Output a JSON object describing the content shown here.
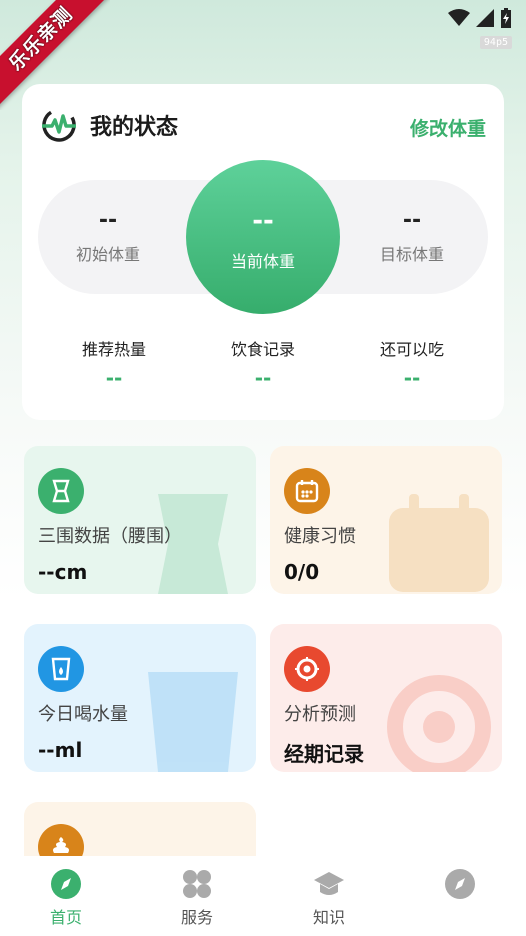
{
  "statusbar": {
    "fps": "94p5"
  },
  "ribbon": {
    "text": "乐乐亲测"
  },
  "status_card": {
    "title": "我的状态",
    "edit_label": "修改体重",
    "initial": {
      "value": "--",
      "label": "初始体重"
    },
    "current": {
      "value": "--",
      "label": "当前体重"
    },
    "target": {
      "value": "--",
      "label": "目标体重"
    },
    "stats": [
      {
        "label": "推荐热量",
        "value": "--"
      },
      {
        "label": "饮食记录",
        "value": "--"
      },
      {
        "label": "还可以吃",
        "value": "--"
      }
    ]
  },
  "tiles": [
    {
      "title": "三围数据（腰围）",
      "value": "--cm",
      "icon": "waist-icon",
      "color": "#3bb06e"
    },
    {
      "title": "健康习惯",
      "value": "0/0",
      "icon": "calendar-icon",
      "color": "#d8841a"
    },
    {
      "title": "今日喝水量",
      "value": "--ml",
      "icon": "water-cup-icon",
      "color": "#2196e3"
    },
    {
      "title": "分析预测",
      "value": "经期记录",
      "icon": "flower-icon",
      "color": "#e8492f"
    },
    {
      "title": "",
      "value": "",
      "icon": "poop-icon",
      "color": "#d8841a"
    }
  ],
  "tabs": [
    {
      "label": "首页",
      "icon": "compass-icon",
      "active": true
    },
    {
      "label": "服务",
      "icon": "grid-icon",
      "active": false
    },
    {
      "label": "知识",
      "icon": "graduation-cap-icon",
      "active": false
    },
    {
      "label": "",
      "icon": "profile-compass-icon",
      "active": false
    }
  ],
  "colors": {
    "accent": "#3bb06e",
    "ribbon": "#c8102e"
  }
}
